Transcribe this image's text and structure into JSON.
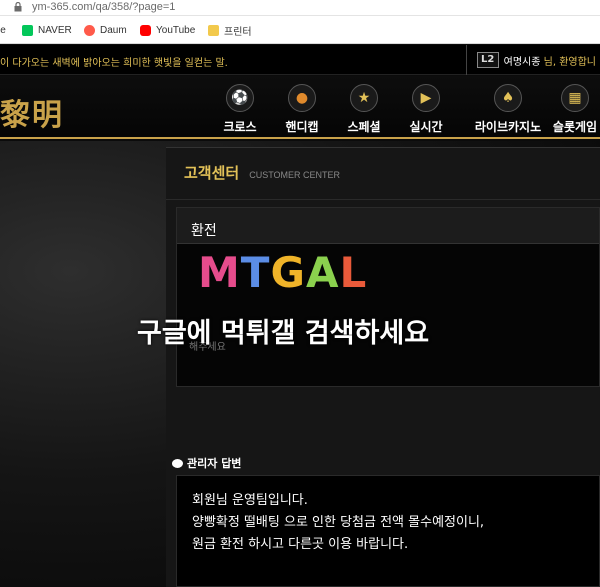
{
  "browser": {
    "url": "ym-365.com/qa/358/?page=1",
    "bookmarks": [
      {
        "label": "le",
        "icon": "google-icon",
        "color": "#4285f4"
      },
      {
        "label": "NAVER",
        "icon": "naver-icon",
        "color": "#03c75a"
      },
      {
        "label": "Daum",
        "icon": "daum-icon",
        "color": "#ff5a4a"
      },
      {
        "label": "YouTube",
        "icon": "youtube-icon",
        "color": "#ff0000"
      },
      {
        "label": "프린터",
        "icon": "folder-icon",
        "color": "#f2c94c"
      }
    ]
  },
  "topbar": {
    "marquee": "이 다가오는 새벽에 밝아오는 희미한 햇빛을 일컫는 말.",
    "level": "L2",
    "username": "여명시종",
    "greeting": " 님, 환영합니"
  },
  "nav": {
    "logo": "黎明",
    "items": [
      {
        "label": "크로스",
        "icon": "soccer-ball-icon",
        "glyph": "⚽"
      },
      {
        "label": "핸디캡",
        "icon": "basketball-icon",
        "glyph": "●"
      },
      {
        "label": "스페셜",
        "icon": "star-icon",
        "glyph": "★"
      },
      {
        "label": "실시간",
        "icon": "live-screen-icon",
        "glyph": "▶"
      },
      {
        "label": "라이브카지노",
        "icon": "cards-icon",
        "glyph": "♠"
      },
      {
        "label": "슬롯게임",
        "icon": "slot-machine-icon",
        "glyph": "▦"
      }
    ]
  },
  "panel": {
    "title": "고객센터",
    "subtitle": "CUSTOMER CENTER",
    "post_title": "환전",
    "post_body": "해주세요"
  },
  "watermark": {
    "logo_letters": [
      "M",
      "T",
      "G",
      "A",
      "L"
    ],
    "logo_colors": [
      "#e64c8c",
      "#5b8de6",
      "#f0b429",
      "#8bd14e",
      "#e95a3a"
    ],
    "text": "구글에 먹튀갤 검색하세요"
  },
  "reply": {
    "header": "관리자 답변",
    "lines": [
      "회원님 운영팀입니다.",
      "양빵확정 떨배팅 으로 인한 당첨금 전액 몰수예정이니,",
      "원금 환전 하시고 다른곳 이용 바랍니다."
    ]
  }
}
